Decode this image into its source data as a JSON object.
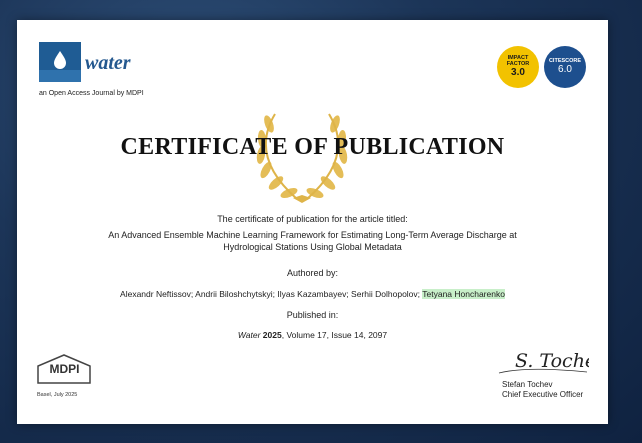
{
  "journal": {
    "name": "water",
    "tagline": "an Open Access Journal by MDPI"
  },
  "badges": {
    "impact_label": "IMPACT FACTOR",
    "impact_value": "3.0",
    "citescore_label": "CITESCORE",
    "citescore_value": "6.0"
  },
  "certificate": {
    "title": "CERTIFICATE OF PUBLICATION",
    "intro": "The certificate of publication for the article titled:",
    "article_title_line1": "An Advanced Ensemble Machine Learning Framework for Estimating Long-Term Average Discharge at",
    "article_title_line2": "Hydrological Stations Using Global Metadata",
    "authored_label": "Authored by:",
    "authors": "Alexandr Neftissov; Andrii Biloshchytskyi; Ilyas Kazambayev; Serhii Dolhopolov;",
    "highlighted_author": "Tetyana Honcharenko",
    "published_label": "Published in:",
    "citation_journal": "Water",
    "citation_year": "2025",
    "citation_rest": ", Volume 17, Issue 14, 2097"
  },
  "footer": {
    "publisher_logo": "MDPI",
    "place_date": "Basel, July 2025",
    "signature": "S. Tochev",
    "signer_name": "Stefan Tochev",
    "signer_title": "Chief Executive Officer"
  },
  "colors": {
    "background": "#1c3558",
    "journal_blue": "#24588f",
    "impact_yellow": "#f2c200",
    "citescore_blue": "#1d4f8e",
    "laurel_gold": "#e0b23a",
    "author_highlight": "#c8efc9"
  },
  "icons": [
    "water-drop-icon",
    "laurel-wreath-icon",
    "mdpi-logo-icon"
  ]
}
